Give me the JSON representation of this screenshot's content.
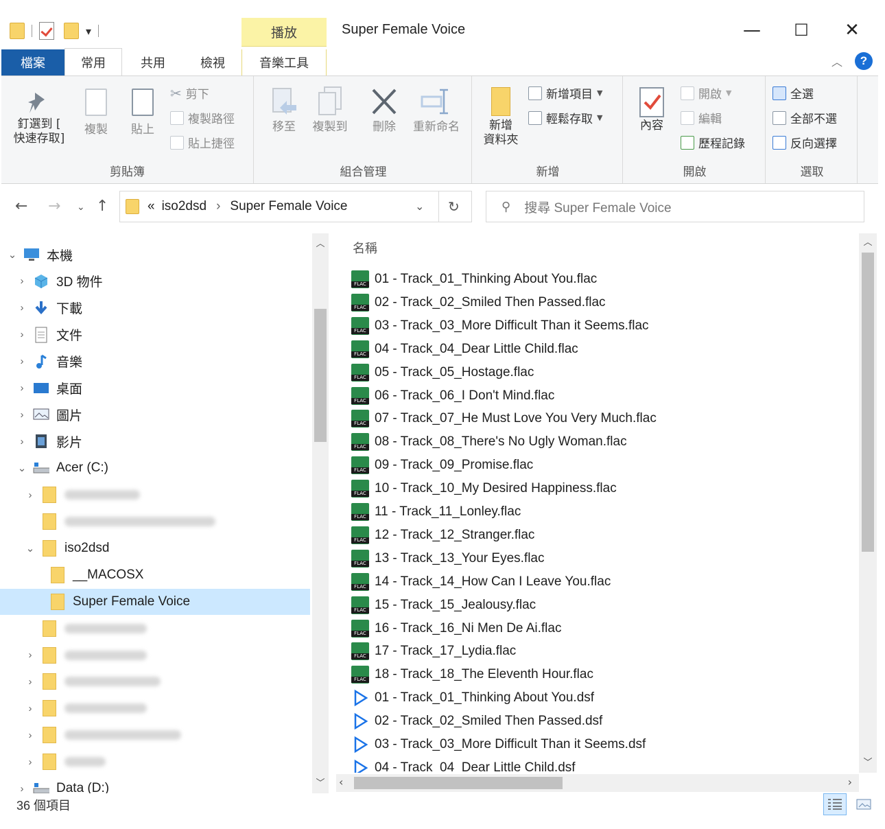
{
  "window": {
    "title": "Super Female Voice",
    "context_tab_group": "播放",
    "controls": {
      "minimize": "—",
      "maximize": "☐",
      "close": "✕"
    }
  },
  "ribbon_tabs": [
    {
      "label": "檔案",
      "active": false
    },
    {
      "label": "常用",
      "active": true
    },
    {
      "label": "共用",
      "active": false
    },
    {
      "label": "檢視",
      "active": false
    },
    {
      "label": "音樂工具",
      "active": false
    }
  ],
  "ribbon": {
    "clipboard": {
      "label": "剪貼簿",
      "pin": "釘選到 [\n快速存取]",
      "copy": "複製",
      "paste": "貼上",
      "cut": "剪下",
      "copy_path": "複製路徑",
      "paste_shortcut": "貼上捷徑"
    },
    "organize": {
      "label": "組合管理",
      "move_to": "移至",
      "copy_to": "複製到",
      "delete": "刪除",
      "rename": "重新命名"
    },
    "new": {
      "label": "新增",
      "new_folder": "新增\n資料夾",
      "new_item": "新增項目",
      "easy_access": "輕鬆存取"
    },
    "open": {
      "label": "開啟",
      "properties": "內容",
      "open": "開啟",
      "edit": "編輯",
      "history": "歷程記錄"
    },
    "select": {
      "label": "選取",
      "select_all": "全選",
      "select_none": "全部不選",
      "invert": "反向選擇"
    }
  },
  "address_bar": {
    "prefix": "«",
    "path": [
      "iso2dsd",
      "Super Female Voice"
    ],
    "separator": "›",
    "search_placeholder": "搜尋 Super Female Voice"
  },
  "nav_pane": {
    "items": [
      {
        "label": "本機",
        "icon": "computer-icon",
        "chevron": "⌄",
        "level": 0
      },
      {
        "label": "3D 物件",
        "icon": "cube-3d-icon",
        "chevron": "›",
        "level": 1
      },
      {
        "label": "下載",
        "icon": "download-icon",
        "chevron": "›",
        "level": 1
      },
      {
        "label": "文件",
        "icon": "document-icon",
        "chevron": "›",
        "level": 1
      },
      {
        "label": "音樂",
        "icon": "music-icon",
        "chevron": "›",
        "level": 1
      },
      {
        "label": "桌面",
        "icon": "desktop-icon",
        "chevron": "›",
        "level": 1
      },
      {
        "label": "圖片",
        "icon": "pictures-icon",
        "chevron": "›",
        "level": 1
      },
      {
        "label": "影片",
        "icon": "video-icon",
        "chevron": "›",
        "level": 1
      },
      {
        "label": "Acer (C:)",
        "icon": "drive-icon",
        "chevron": "⌄",
        "level": 1
      },
      {
        "label": "",
        "icon": "folder-icon",
        "chevron": "›",
        "level": 2,
        "blurred": true
      },
      {
        "label": "",
        "icon": "folder-icon",
        "chevron": "",
        "level": 2,
        "blurred": true
      },
      {
        "label": "iso2dsd",
        "icon": "folder-icon",
        "chevron": "⌄",
        "level": 2
      },
      {
        "label": "__MACOSX",
        "icon": "folder-icon",
        "chevron": "",
        "level": 3
      },
      {
        "label": "Super Female Voice",
        "icon": "folder-icon",
        "chevron": "",
        "level": 3,
        "selected": true
      },
      {
        "label": "",
        "icon": "folder-icon",
        "chevron": "",
        "level": 2,
        "blurred": true
      },
      {
        "label": "",
        "icon": "folder-icon",
        "chevron": "›",
        "level": 2,
        "blurred": true
      },
      {
        "label": "",
        "icon": "folder-icon",
        "chevron": "›",
        "level": 2,
        "blurred": true
      },
      {
        "label": "",
        "icon": "folder-icon",
        "chevron": "›",
        "level": 2,
        "blurred": true
      },
      {
        "label": "",
        "icon": "folder-icon",
        "chevron": "›",
        "level": 2,
        "blurred": true
      },
      {
        "label": "",
        "icon": "folder-icon",
        "chevron": "›",
        "level": 2,
        "blurred": true
      },
      {
        "label": "Data (D:)",
        "icon": "drive-icon",
        "chevron": "›",
        "level": 1
      }
    ]
  },
  "file_list": {
    "column_header": "名稱",
    "files": [
      {
        "name": "01 - Track_01_Thinking About You.flac",
        "type": "flac"
      },
      {
        "name": "02 - Track_02_Smiled Then Passed.flac",
        "type": "flac"
      },
      {
        "name": "03 - Track_03_More Difficult Than it Seems.flac",
        "type": "flac"
      },
      {
        "name": "04 - Track_04_Dear Little Child.flac",
        "type": "flac"
      },
      {
        "name": "05 - Track_05_Hostage.flac",
        "type": "flac"
      },
      {
        "name": "06 - Track_06_I Don't Mind.flac",
        "type": "flac"
      },
      {
        "name": "07 - Track_07_He Must Love You Very Much.flac",
        "type": "flac"
      },
      {
        "name": "08 - Track_08_There's No Ugly Woman.flac",
        "type": "flac"
      },
      {
        "name": "09 - Track_09_Promise.flac",
        "type": "flac"
      },
      {
        "name": "10 - Track_10_My Desired Happiness.flac",
        "type": "flac"
      },
      {
        "name": "11 - Track_11_Lonley.flac",
        "type": "flac"
      },
      {
        "name": "12 - Track_12_Stranger.flac",
        "type": "flac"
      },
      {
        "name": "13 - Track_13_Your Eyes.flac",
        "type": "flac"
      },
      {
        "name": "14 - Track_14_How Can I Leave You.flac",
        "type": "flac"
      },
      {
        "name": "15 - Track_15_Jealousy.flac",
        "type": "flac"
      },
      {
        "name": "16 - Track_16_Ni Men De Ai.flac",
        "type": "flac"
      },
      {
        "name": "17 - Track_17_Lydia.flac",
        "type": "flac"
      },
      {
        "name": "18 - Track_18_The Eleventh Hour.flac",
        "type": "flac"
      },
      {
        "name": "01 - Track_01_Thinking About You.dsf",
        "type": "dsf"
      },
      {
        "name": "02 - Track_02_Smiled Then Passed.dsf",
        "type": "dsf"
      },
      {
        "name": "03 - Track_03_More Difficult Than it Seems.dsf",
        "type": "dsf"
      },
      {
        "name": "04 - Track_04_Dear Little Child.dsf",
        "type": "dsf"
      }
    ]
  },
  "status_bar": {
    "item_count": "36 個項目"
  },
  "colors": {
    "accent": "#1a5ea8",
    "selection": "#cce8ff",
    "context_tab": "#fbf3a6",
    "flac_icon": "#2a8a4a",
    "dsf_icon": "#1a73e8"
  }
}
